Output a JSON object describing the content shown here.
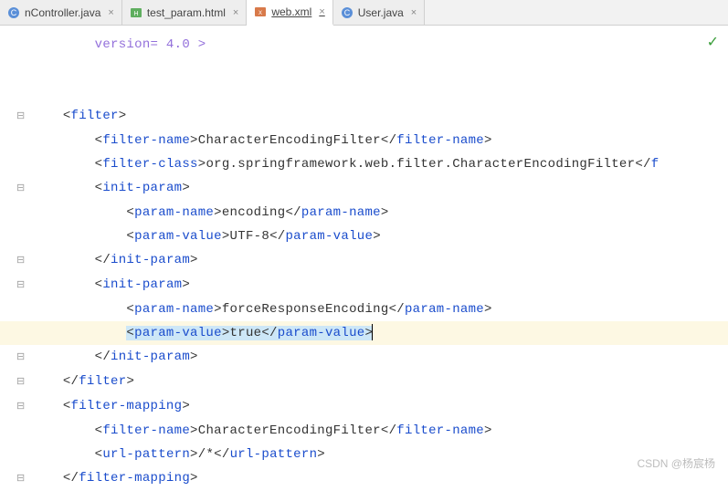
{
  "tabs": [
    {
      "label": "nController.java",
      "icon": "java-class-icon",
      "active": false
    },
    {
      "label": "test_param.html",
      "icon": "html-file-icon",
      "active": false
    },
    {
      "label": "web.xml",
      "icon": "xml-file-icon",
      "active": true
    },
    {
      "label": "User.java",
      "icon": "java-class-icon",
      "active": false
    }
  ],
  "truncated_line": "version= 4.0 >",
  "code": {
    "filter_open": "filter",
    "filter_name_tag": "filter-name",
    "filter_name_value": "CharacterEncodingFilter",
    "filter_class_tag": "filter-class",
    "filter_class_value": "org.springframework.web.filter.CharacterEncodingFilter",
    "filter_class_value_cut": "f",
    "init_param_tag": "init-param",
    "param_name_tag": "param-name",
    "param_value_tag": "param-value",
    "param1_name": "encoding",
    "param1_value": "UTF-8",
    "param2_name": "forceResponseEncoding",
    "param2_value": "true",
    "filter_mapping_tag": "filter-mapping",
    "url_pattern_tag": "url-pattern",
    "url_pattern_value": "/*"
  },
  "status_ok": "✓",
  "watermark": "CSDN @杨宸杨"
}
